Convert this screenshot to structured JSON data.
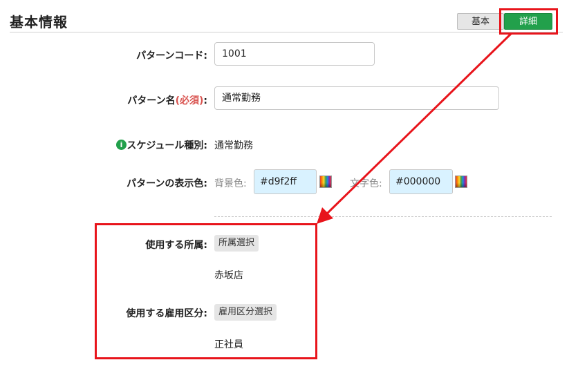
{
  "header": {
    "title": "基本情報",
    "tabs": {
      "basic": "基本",
      "detail": "詳細"
    }
  },
  "form": {
    "pattern_code": {
      "label": "パターンコード:",
      "value": "1001"
    },
    "pattern_name": {
      "label_main": "パターン名",
      "label_required": "(必須)",
      "label_colon": ":",
      "value": "通常勤務"
    },
    "schedule_type": {
      "info_icon_glyph": "i",
      "label": "スケジュール種別:",
      "value": "通常勤務"
    },
    "display_color": {
      "label": "パターンの表示色:",
      "background_label": "背景色:",
      "background_value": "#d9f2ff",
      "text_label": "文字色:",
      "text_value": "#000000"
    },
    "department": {
      "label": "使用する所属:",
      "button": "所属選択",
      "value": "赤坂店"
    },
    "employment": {
      "label": "使用する雇用区分:",
      "button": "雇用区分選択",
      "value": "正社員"
    }
  },
  "colors": {
    "active_tab": "#22a04b",
    "annotation": "#e8141b",
    "required": "#d9534f",
    "color_swatch_bg": "#d9f2ff"
  }
}
